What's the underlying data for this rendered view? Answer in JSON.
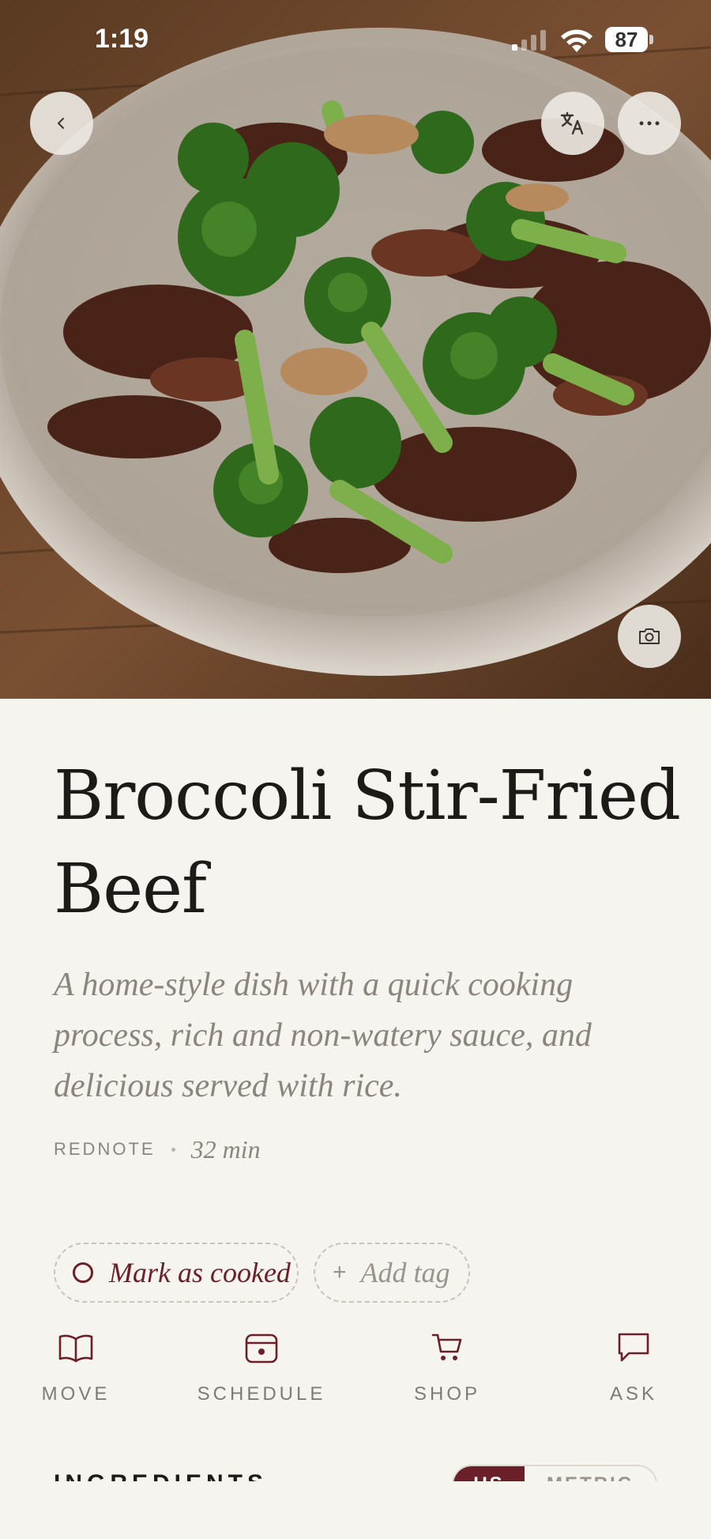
{
  "status_bar": {
    "time": "1:19",
    "battery": "87"
  },
  "header": {
    "back_icon": "chevron-left-icon",
    "translate_icon": "translate-icon",
    "more_icon": "more-horizontal-icon",
    "camera_icon": "camera-icon"
  },
  "recipe": {
    "title": "Broccoli Stir-Fried Beef",
    "description": "A home-style dish with a quick cooking process, rich and non-watery sauce, and delicious served with rice.",
    "source": "REDNOTE",
    "duration": "32 min"
  },
  "pills": {
    "cooked_label": "Mark as cooked",
    "add_tag_label": "Add tag",
    "add_tag_symbol": "+"
  },
  "actions": [
    {
      "label": "MOVE",
      "icon": "book-open-icon"
    },
    {
      "label": "SCHEDULE",
      "icon": "calendar-icon"
    },
    {
      "label": "SHOP",
      "icon": "cart-icon"
    },
    {
      "label": "ASK",
      "icon": "chat-bubble-icon"
    }
  ],
  "ingredients": {
    "heading": "INGREDIENTS",
    "unit_us": "US",
    "unit_metric": "METRIC"
  },
  "colors": {
    "accent": "#6b1f28",
    "background": "#f6f4ef",
    "muted": "#8b857e"
  }
}
